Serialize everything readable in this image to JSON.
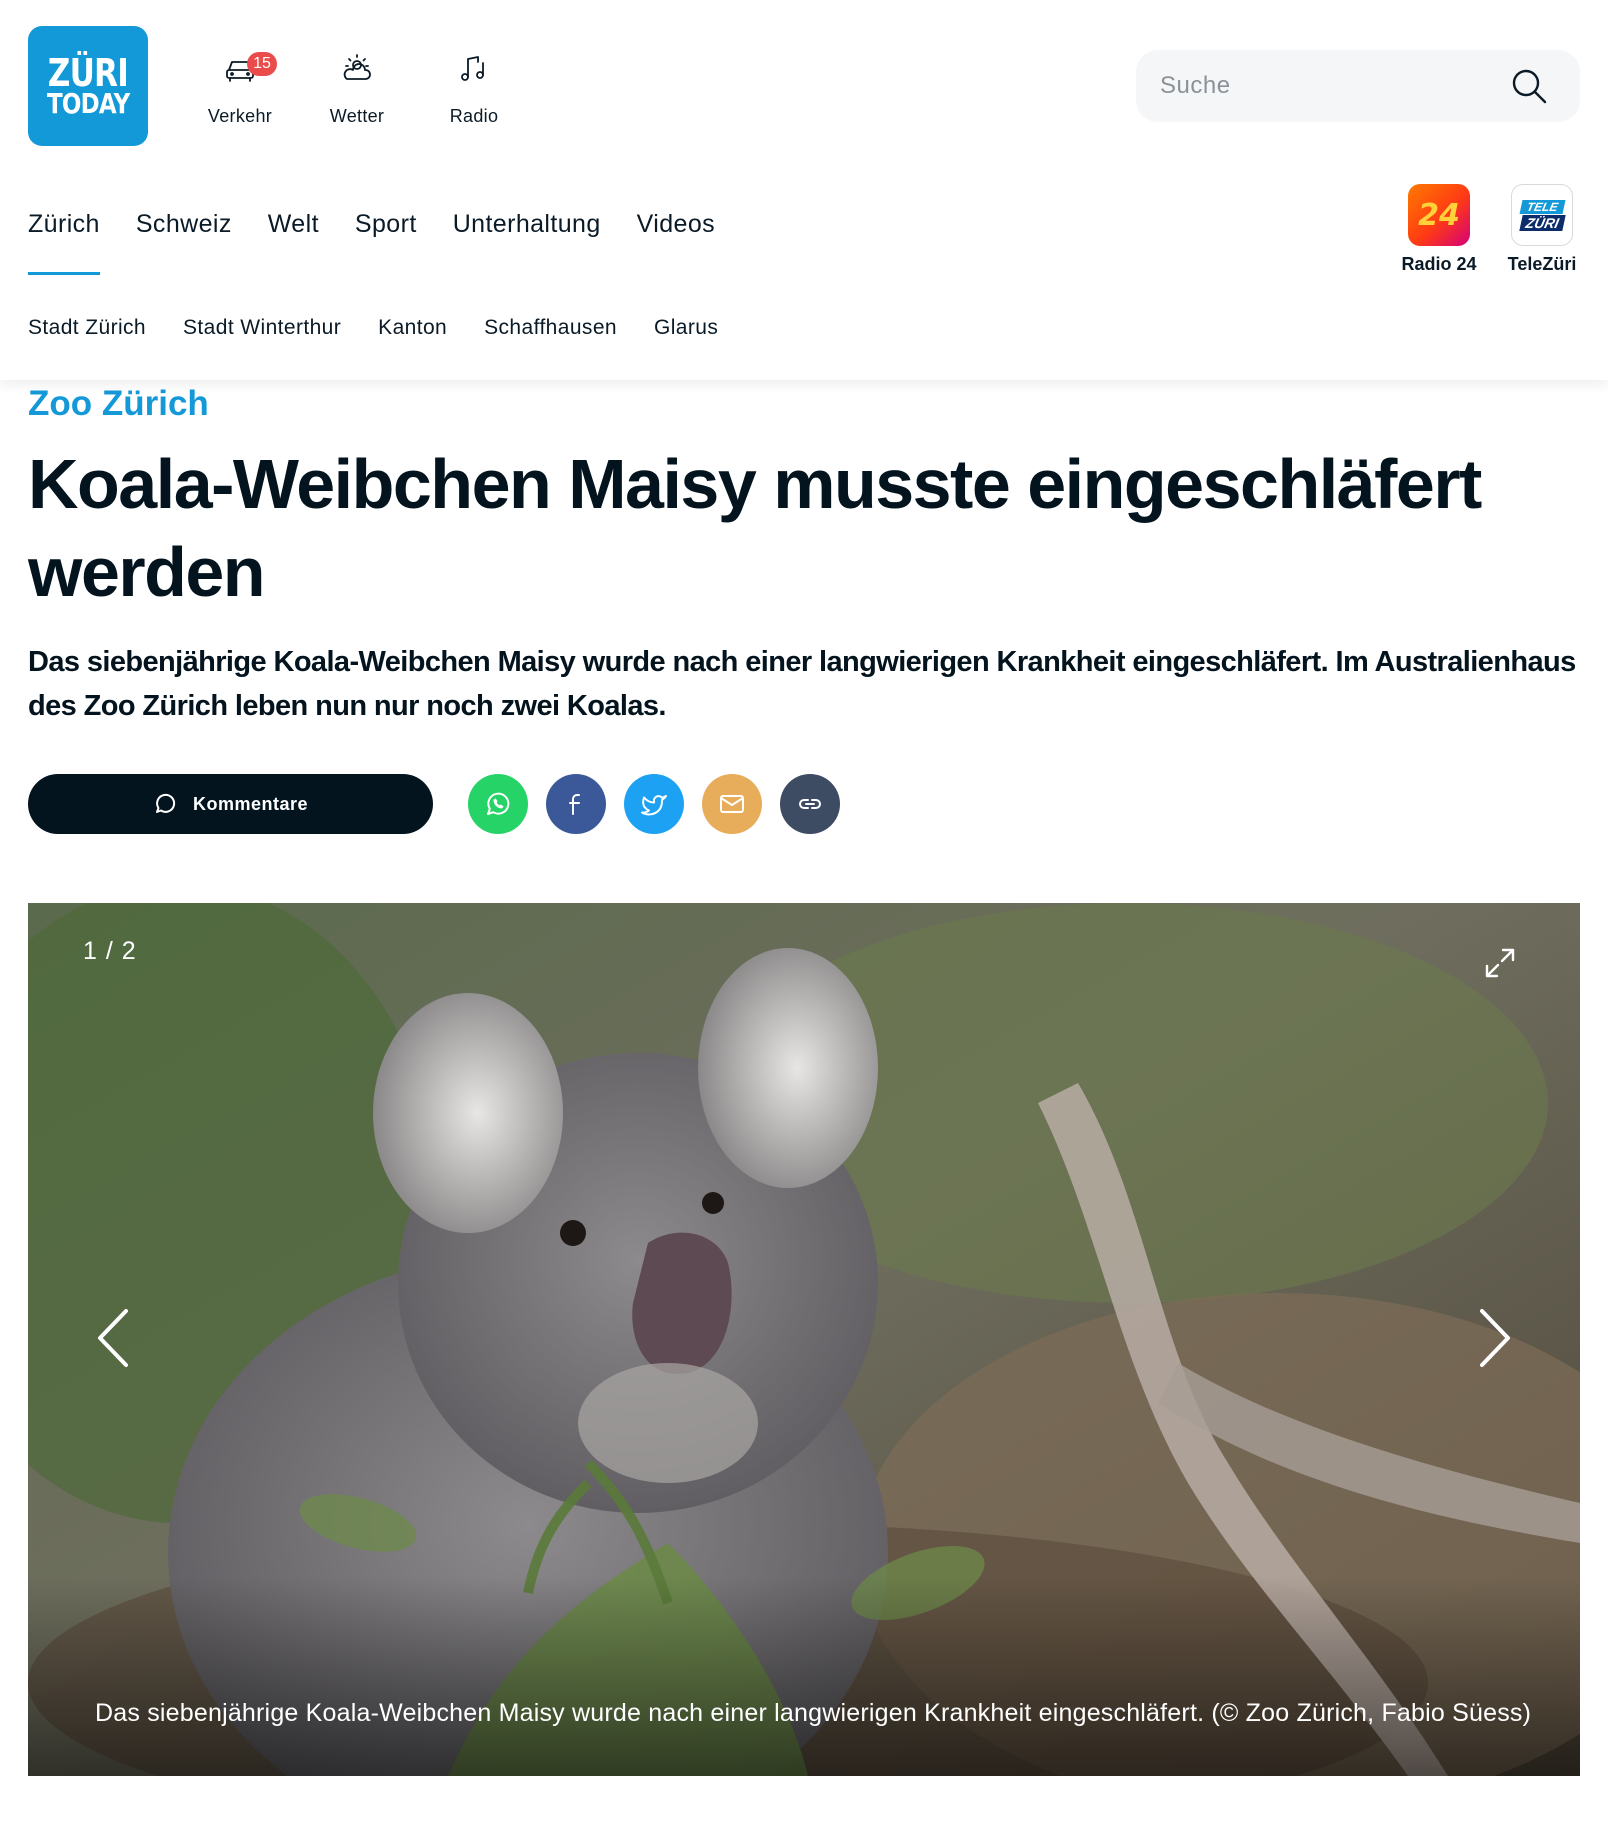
{
  "logo": {
    "line1": "ZÜRI",
    "line2": "TODAY"
  },
  "quick_links": [
    {
      "label": "Verkehr",
      "icon": "car-icon",
      "badge": "15"
    },
    {
      "label": "Wetter",
      "icon": "cloud-sun-icon"
    },
    {
      "label": "Radio",
      "icon": "music-note-icon"
    }
  ],
  "search": {
    "placeholder": "Suche",
    "icon": "search-icon"
  },
  "main_nav": {
    "items": [
      "Zürich",
      "Schweiz",
      "Welt",
      "Sport",
      "Unterhaltung",
      "Videos"
    ],
    "active": "Zürich"
  },
  "brands": [
    {
      "label": "Radio 24",
      "logo_text": "24"
    },
    {
      "label": "TeleZüri",
      "logo_text_1": "TELE",
      "logo_text_2": "ZÜRI"
    }
  ],
  "sub_nav": {
    "items": [
      "Stadt Zürich",
      "Stadt Winterthur",
      "Kanton",
      "Schaffhausen",
      "Glarus"
    ]
  },
  "article": {
    "kicker": "Zoo Zürich",
    "title": "Koala-Weibchen Maisy musste eingeschlä­fert werden",
    "lead": "Das siebenjährige Koala-Weibchen Maisy wurde nach einer langwierigen Krankheit eingeschläfert. Im Australienhaus des Zoo Zürich leben nun nur noch zwei Koalas.",
    "comments_label": "Kommentare",
    "share_icons": [
      "whatsapp-icon",
      "facebook-icon",
      "twitter-icon",
      "mail-icon",
      "link-icon"
    ]
  },
  "gallery": {
    "counter": "1 / 2",
    "caption": "Das siebenjährige Koala-Weibchen Maisy wurde nach einer langwierigen Krankheit eingeschläfert. (© Zoo Zürich, Fabio Süess)"
  },
  "colors": {
    "brand_blue": "#1399d8",
    "text_dark": "#04141f",
    "badge_red": "#ea4b4b",
    "whatsapp": "#25d366",
    "facebook": "#3b5998",
    "twitter": "#1da1f2",
    "mail": "#e7ad5a",
    "link": "#3d4c62"
  }
}
